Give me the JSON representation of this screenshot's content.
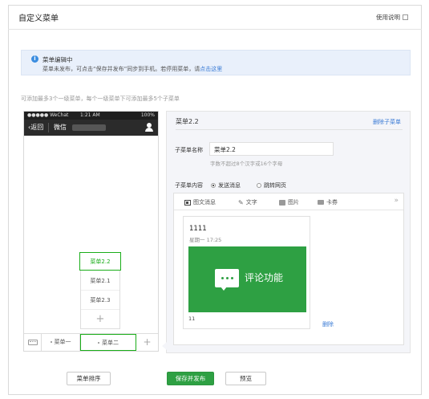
{
  "header": {
    "title": "自定义菜单",
    "help_label": "使用说明"
  },
  "notice": {
    "icon": "info-icon",
    "title": "菜单编辑中",
    "text": "菜单未发布，可点击“保存并发布”同步到手机。若停用菜单，请",
    "link": "点击这里"
  },
  "hint": "可添加最多3个一级菜单，每个一级菜单下可添加最多5个子菜单",
  "phone": {
    "status": {
      "carrier": "●●●●● WeChat",
      "time": "1:21 AM",
      "battery": "100%"
    },
    "nav": {
      "back": "返回",
      "name": "微信"
    },
    "submenu": [
      "菜单2.2",
      "菜单2.1",
      "菜单2.3"
    ],
    "submenu_add": "+",
    "tabs": [
      "菜单一",
      "菜单二"
    ],
    "tab_add": "+"
  },
  "editor": {
    "title": "菜单2.2",
    "delete_label": "删除子菜单",
    "name_label": "子菜单名称",
    "name_value": "菜单2.2",
    "name_tip": "字数不超过8个汉字或16个字母",
    "content_label": "子菜单内容",
    "options": [
      "发送消息",
      "跳转网页"
    ],
    "content_tabs": [
      "图文消息",
      "文字",
      "图片",
      "卡券"
    ],
    "more": "»",
    "article": {
      "title": "1111",
      "date": "星期一 17:25",
      "image_text": "评论功能",
      "footer": "11"
    },
    "item_delete": "删除"
  },
  "footer": {
    "sort": "菜单排序",
    "save": "保存并发布",
    "preview": "预览"
  },
  "colors": {
    "accent": "#1aad19",
    "button": "#2ea043",
    "link": "#3a7bd5",
    "notice_bg": "#e9f0fb"
  }
}
